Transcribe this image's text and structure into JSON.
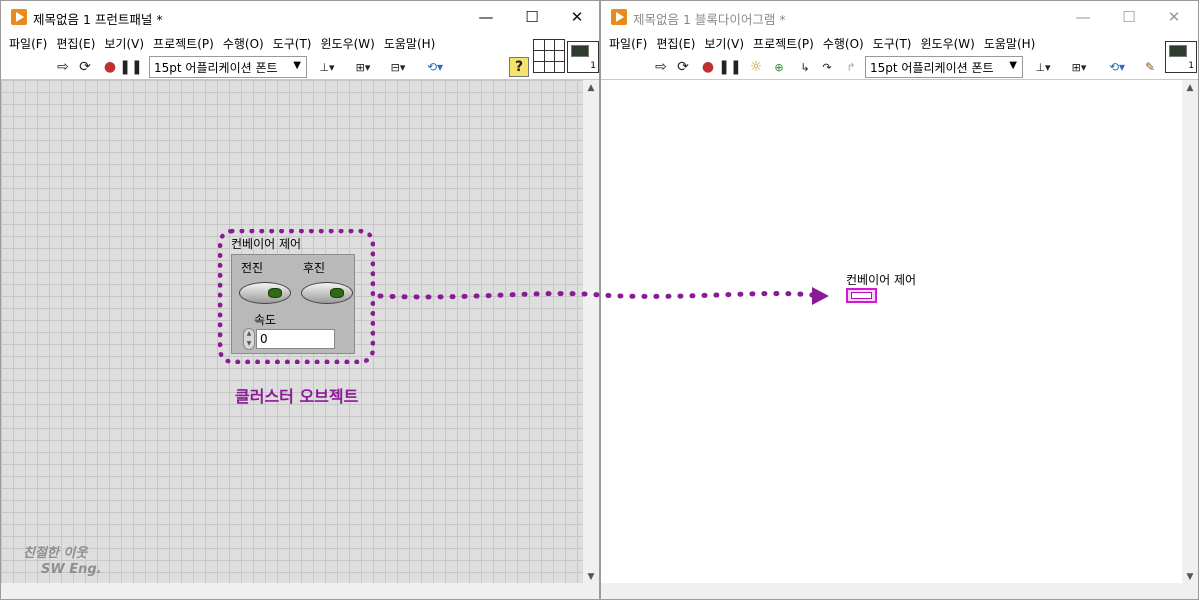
{
  "front_panel": {
    "title": "제목없음 1 프런트패널 *",
    "menu": [
      "파일(F)",
      "편집(E)",
      "보기(V)",
      "프로젝트(P)",
      "수행(O)",
      "도구(T)",
      "윈도우(W)",
      "도움말(H)"
    ],
    "font_selector": "15pt 어플리케이션 폰트",
    "icon_number": "1",
    "cluster": {
      "label": "컨베이어 제어",
      "forward_label": "전진",
      "backward_label": "후진",
      "speed_label": "속도",
      "speed_value": "0"
    },
    "caption": "클러스터 오브젝트"
  },
  "block_diagram": {
    "title": "제목없음 1 블록다이어그램 *",
    "menu": [
      "파일(F)",
      "편집(E)",
      "보기(V)",
      "프로젝트(P)",
      "수행(O)",
      "도구(T)",
      "윈도우(W)",
      "도움말(H)"
    ],
    "font_selector": "15pt 어플리케이션 폰트",
    "icon_number": "1",
    "terminal_label": "컨베이어 제어"
  },
  "watermark": {
    "line1": "친절한 이웃",
    "line2": "SW Eng."
  },
  "colors": {
    "highlight": "#8b1a96",
    "cluster_wire": "#d516d5",
    "led_green": "#2f6b14"
  }
}
